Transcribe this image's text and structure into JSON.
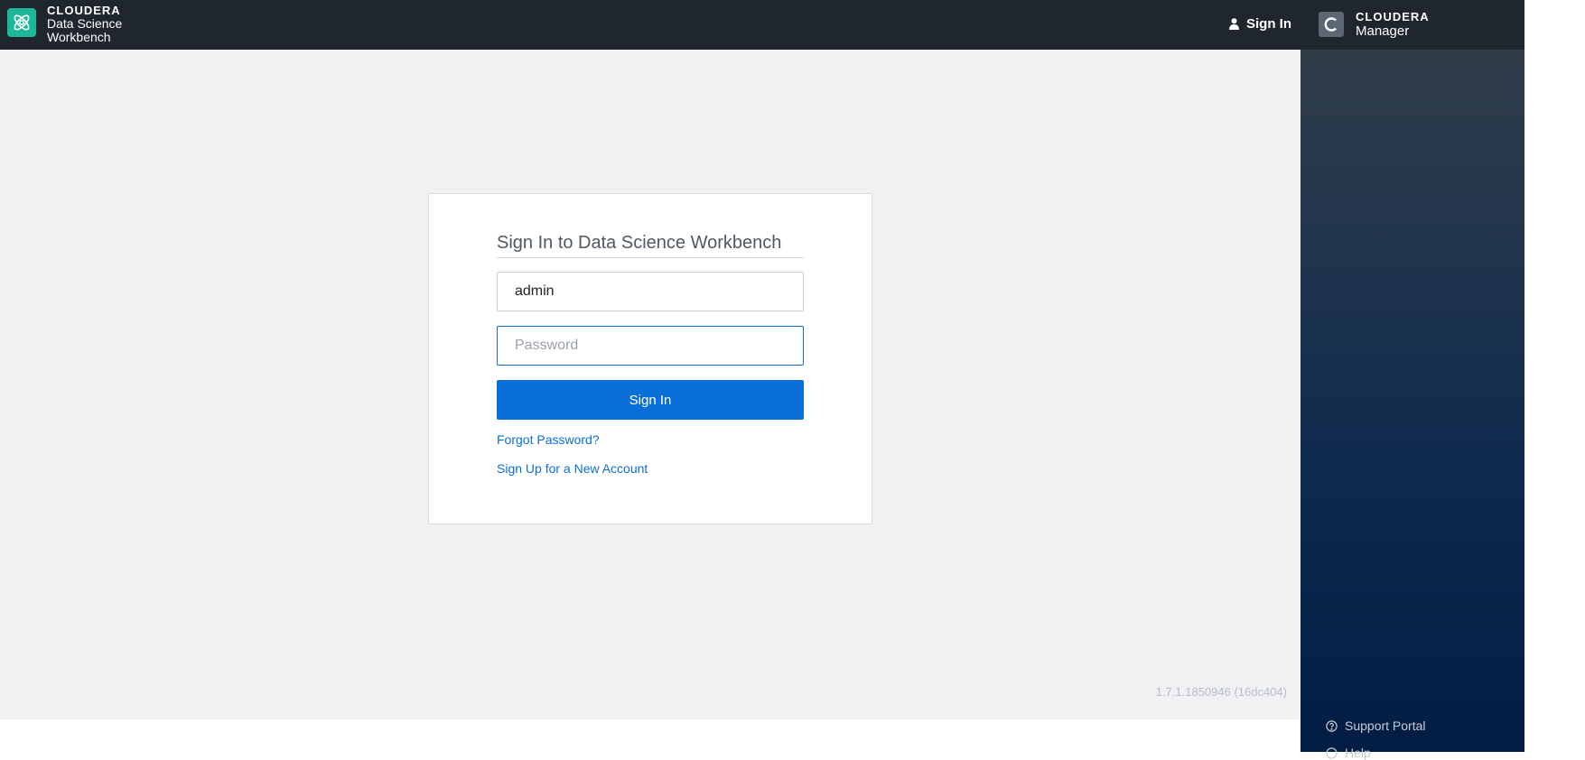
{
  "topbar": {
    "brand_word": "CLOUDERA",
    "brand_line1": "Data Science",
    "brand_line2": "Workbench",
    "signin_label": "Sign In"
  },
  "login": {
    "title": "Sign In to Data Science Workbench",
    "username_value": "admin",
    "password_placeholder": "Password",
    "submit_label": "Sign In",
    "forgot_label": "Forgot Password?",
    "signup_label": "Sign Up for a New Account"
  },
  "footer": {
    "version": "1.7.1.1850946 (16dc404)"
  },
  "cm_panel": {
    "brand_word": "CLOUDERA",
    "brand_sub": "Manager",
    "support_label": "Support Portal",
    "help_label": "Help"
  },
  "colors": {
    "brand_accent": "#1db89c",
    "primary_button": "#0a6fd9",
    "topbar": "#1f262e"
  },
  "icons": [
    "atom-logo-icon",
    "user-icon",
    "cloudera-c-icon",
    "question-circle-icon"
  ]
}
